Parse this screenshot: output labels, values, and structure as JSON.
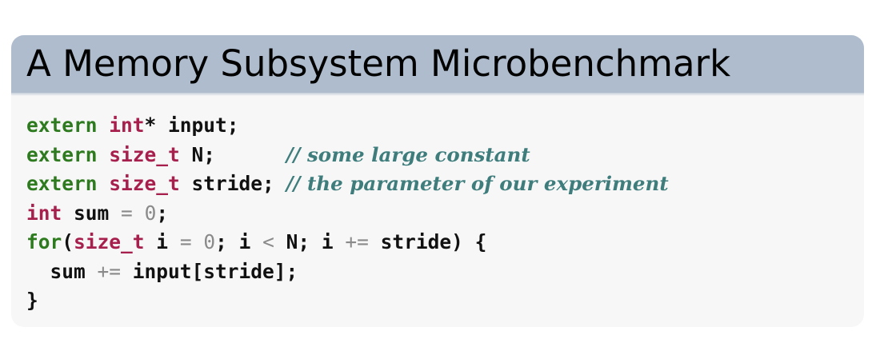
{
  "slide": {
    "title": "A Memory Subsystem Microbenchmark"
  },
  "code": {
    "lines": [
      [
        {
          "t": "extern",
          "k": "kw"
        },
        {
          "t": " ",
          "k": "id"
        },
        {
          "t": "int",
          "k": "ty"
        },
        {
          "t": "* input;",
          "k": "id"
        }
      ],
      [
        {
          "t": "extern",
          "k": "kw"
        },
        {
          "t": " ",
          "k": "id"
        },
        {
          "t": "size_t",
          "k": "ty"
        },
        {
          "t": " N;      ",
          "k": "id"
        },
        {
          "t": "// some large constant",
          "k": "cm"
        }
      ],
      [
        {
          "t": "extern",
          "k": "kw"
        },
        {
          "t": " ",
          "k": "id"
        },
        {
          "t": "size_t",
          "k": "ty"
        },
        {
          "t": " stride; ",
          "k": "id"
        },
        {
          "t": "// the parameter of our experiment",
          "k": "cm"
        }
      ],
      [
        {
          "t": "int",
          "k": "ty"
        },
        {
          "t": " sum ",
          "k": "id"
        },
        {
          "t": "=",
          "k": "op"
        },
        {
          "t": " ",
          "k": "id"
        },
        {
          "t": "0",
          "k": "num"
        },
        {
          "t": ";",
          "k": "id"
        }
      ],
      [
        {
          "t": "for",
          "k": "kw"
        },
        {
          "t": "(",
          "k": "id"
        },
        {
          "t": "size_t",
          "k": "ty"
        },
        {
          "t": " i ",
          "k": "id"
        },
        {
          "t": "=",
          "k": "op"
        },
        {
          "t": " ",
          "k": "id"
        },
        {
          "t": "0",
          "k": "num"
        },
        {
          "t": "; i ",
          "k": "id"
        },
        {
          "t": "<",
          "k": "op"
        },
        {
          "t": " N; i ",
          "k": "id"
        },
        {
          "t": "+=",
          "k": "op"
        },
        {
          "t": " stride) {",
          "k": "id"
        }
      ],
      [
        {
          "t": "  sum ",
          "k": "id"
        },
        {
          "t": "+=",
          "k": "op"
        },
        {
          "t": " input[stride];",
          "k": "id"
        }
      ],
      [
        {
          "t": "}",
          "k": "id"
        }
      ]
    ]
  },
  "colors": {
    "title_bar": "#aebccd",
    "block_body": "#f7f7f7",
    "keyword": "#2e7a1f",
    "type": "#a61f4d",
    "comment": "#3f7d7d",
    "operator": "#8a8a8a"
  }
}
